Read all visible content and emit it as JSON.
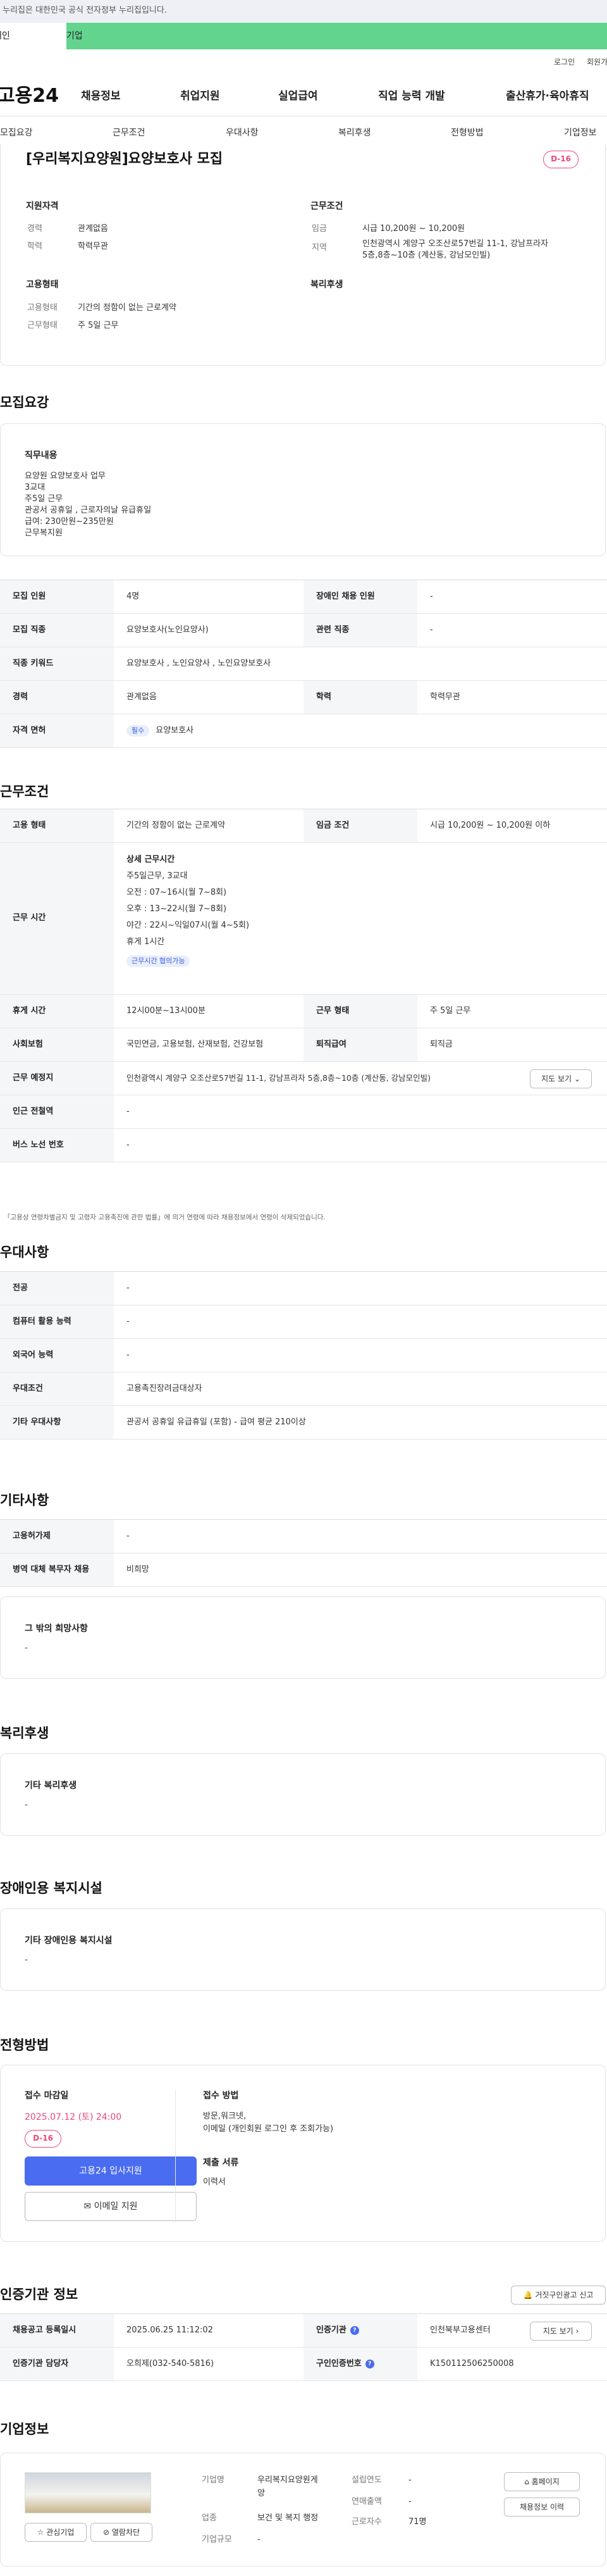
{
  "gov_notice": "이 누리집은 대한민국 공식 전자정부 누리집입니다.",
  "categories": {
    "individual": "개인",
    "company": "기업"
  },
  "util": {
    "login": "로그인",
    "join": "회원가입"
  },
  "logo": "고용24",
  "gnb": [
    "채용정보",
    "취업지원",
    "실업급여",
    "직업 능력 개발",
    "출산휴가·육아휴직"
  ],
  "tabs": [
    "모집요강",
    "근무조건",
    "우대사항",
    "복리후생",
    "전형방법",
    "기업정보"
  ],
  "summary": {
    "title": "[우리복지요양원]요양보호사 모집",
    "dday": "D-16",
    "qual_h": "지원자격",
    "cond_h": "근무조건",
    "qual": [
      {
        "k": "경력",
        "v": "관계없음"
      },
      {
        "k": "학력",
        "v": "학력무관"
      }
    ],
    "cond_wage_k": "임금",
    "cond_wage_v": "시급 10,200원 ~ 10,200원",
    "cond_loc_k": "지역",
    "cond_loc_v1": "인천광역시 계양구 오조산로57번길 11-1, 강남프라자",
    "cond_loc_v2": "5층,8층~10층 (계산동, 강남모인빌)",
    "emp_h": "고용형태",
    "welfare_h": "복리후생",
    "emp": [
      {
        "k": "고용형태",
        "v": "기간의 정함이 없는 근로계약"
      },
      {
        "k": "근무형태",
        "v": "주 5일 근무"
      }
    ]
  },
  "recruit": {
    "title": "모집요강",
    "job_h": "직무내용",
    "job_lines": [
      "요양원 요양보호사 업무",
      "3교대",
      "주5일 근무",
      "관공서 공휴일 , 근로자의날 유급휴일",
      "급여: 230만원~235만원",
      "근무복지원"
    ],
    "rows": {
      "count_k": "모집 인원",
      "count_v": "4명",
      "disabled_k": "장애인 채용 인원",
      "disabled_v": "-",
      "job_k": "모집 직종",
      "job_v": "요양보호사(노인요양사)",
      "rel_k": "관련 직종",
      "rel_v": "-",
      "kw_k": "직종 키워드",
      "kw_v": "요양보호사 , 노인요양사 , 노인요양보호사",
      "career_k": "경력",
      "career_v": "관계없음",
      "edu_k": "학력",
      "edu_v": "학력무관",
      "license_k": "자격 면허",
      "license_badge": "필수",
      "license_v": "요양보호사"
    }
  },
  "work": {
    "title": "근무조건",
    "emptype_k": "고용 형태",
    "emptype_v": "기간의 정함이 없는 근로계약",
    "wage_k": "임금 조건",
    "wage_v": "시급 10,200원 ~ 10,200원 이하",
    "hours_k": "근무 시간",
    "hours_h": "상세 근무시간",
    "hours_lines": [
      "주5일근무,  3교대",
      "오전 : 07~16시(월 7~8회)",
      "오후 : 13~22시(월 7~8회)",
      "야간 : 22시~익일07시(월 4~5회)",
      "휴게 1시간"
    ],
    "hours_badge": "근무시간 협의가능",
    "break_k": "휴게 시간",
    "break_v": "12시00분~13시00분",
    "form_k": "근무 형태",
    "form_v": "주 5일 근무",
    "ins_k": "사회보험",
    "ins_v": "국민연금, 고용보험, 산재보험, 건강보험",
    "sev_k": "퇴직급여",
    "sev_v": "퇴직금",
    "place_k": "근무 예정지",
    "place_v": "인천광역시 계양구 오조산로57번길 11-1, 강남프라자 5층,8층~10층 (계산동, 강남모인빌)",
    "map_btn": "지도 보기",
    "subway_k": "인근 전철역",
    "subway_v": "-",
    "bus_k": "버스 노선 번호",
    "bus_v": "-",
    "note": "「고용상 연령차별금지 및 고령자 고용촉진에 관한 법률」에 의거 연령에 따라 채용정보에서 연령이 삭제되었습니다."
  },
  "pref": {
    "title": "우대사항",
    "rows": [
      {
        "k": "전공",
        "v": "-"
      },
      {
        "k": "컴퓨터 활용 능력",
        "v": "-"
      },
      {
        "k": "외국어 능력",
        "v": "-"
      },
      {
        "k": "우대조건",
        "v": "고용촉진장려금대상자"
      },
      {
        "k": "기타 우대사항",
        "v": "관공서 공휴일 유급휴일 (포함) - 급여  평균 210이상"
      }
    ]
  },
  "etc": {
    "title": "기타사항",
    "rows": [
      {
        "k": "고용허가제",
        "v": "-"
      },
      {
        "k": "병역 대체 복무자 채용",
        "v": "비희망"
      }
    ],
    "hope_h": "그 밖의 희망사항",
    "hope_v": "-"
  },
  "welfare": {
    "title": "복리후생",
    "h": "기타 복리후생",
    "v": "-"
  },
  "disab": {
    "title": "장애인용 복지시설",
    "h": "기타 장애인용 복지시설",
    "v": "-"
  },
  "apply": {
    "title": "전형방법",
    "deadline_h": "접수 마감일",
    "deadline_v": "2025.07.12 (토) 24:00",
    "dday": "D-16",
    "apply_btn": "고용24 입사지원",
    "email_btn": "이메일 지원",
    "method_h": "접수 방법",
    "method_v1": "방문,워크넷,",
    "method_v2": "이메일 (개인회원 로그인 후 조회가능)",
    "docs_h": "제출 서류",
    "docs_v": "이력서"
  },
  "cert": {
    "title": "인증기관 정보",
    "report_btn": "거짓구인광고 신고",
    "reg_k": "채용공고 등록일시",
    "reg_v": "2025.06.25 11:12:02",
    "org_k": "인증기관",
    "org_v": "인천북부고용센터",
    "map_btn": "지도 보기",
    "mgr_k": "인증기관 담당자",
    "mgr_v": "오희제(032-540-5816)",
    "no_k": "구인인증번호",
    "no_v": "K150112506250008"
  },
  "company": {
    "title": "기업정보",
    "interest_btn": "관심기업",
    "block_btn": "열람차단",
    "name_k": "기업명",
    "name_v1": "우리복지요양원게",
    "name_v2": "양",
    "industry_k": "업종",
    "industry_v": "보건 및 복지 행정",
    "size_k": "기업규모",
    "size_v": "-",
    "year_k": "설립연도",
    "year_v": "-",
    "sales_k": "연매출액",
    "sales_v": "-",
    "emp_k": "근로자수",
    "emp_v": "71명",
    "home_btn": "홈페이지",
    "list_btn": "채용정보 이력"
  },
  "colors": {
    "accent_green": "#62d48e",
    "dday_pink": "#e8487a",
    "primary_blue": "#4a6cf0"
  }
}
